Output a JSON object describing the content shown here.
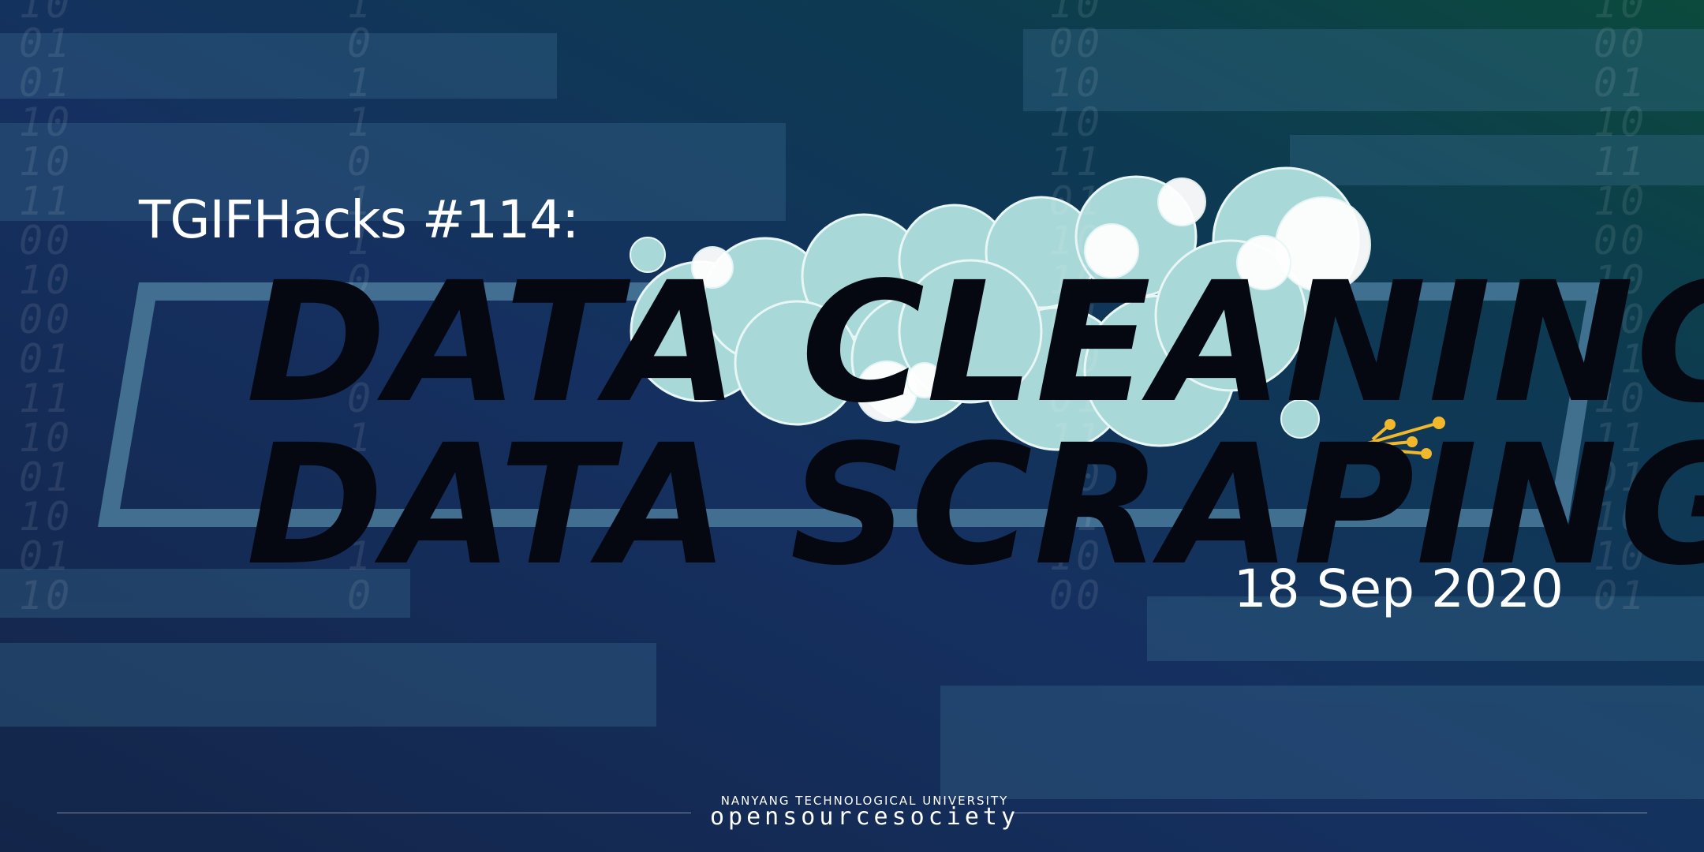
{
  "event_label": "TGIFHacks #114:",
  "title": {
    "line1": "DATA CLEANING &",
    "line2": "DATA SCRAPING"
  },
  "date": "18 Sep 2020",
  "footer": {
    "university": "NANYANG TECHNOLOGICAL UNIVERSITY",
    "organization": "opensourcesociety"
  },
  "colors": {
    "bg_left": "#1a3260",
    "bg_right": "#0b4a42",
    "title_text": "#050811",
    "bubble": "#a8d8d7",
    "frame": "#4a7a9a",
    "sparkle": "#f2b82c"
  },
  "icons": [
    "soap-bubble-cloud",
    "sparkle-icon",
    "binary-digits"
  ]
}
